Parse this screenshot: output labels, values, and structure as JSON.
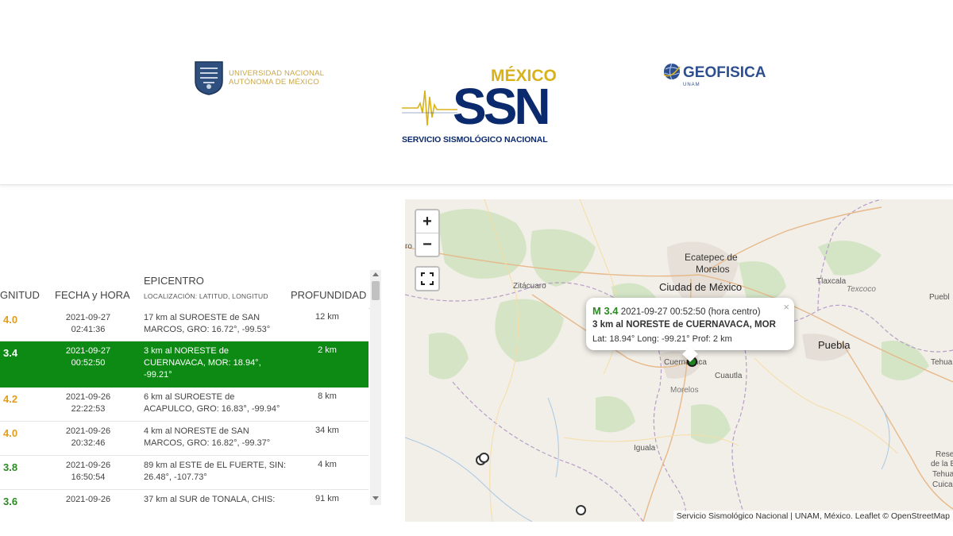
{
  "header": {
    "unam_logo_text_line1": "UNIVERSIDAD NACIONAL",
    "unam_logo_text_line2": "AUTÓNOMA DE MÉXICO",
    "ssn_country": "MÉXICO",
    "ssn_acronym": "SSN",
    "ssn_name": "SERVICIO SISMOLÓGICO NACIONAL",
    "geo_logo_text": "GEOFISICA",
    "geo_logo_sub": "UNAM"
  },
  "table": {
    "columns": {
      "magnitude": "GNITUD",
      "datetime": "FECHA y HORA",
      "epicenter": "EPICENTRO",
      "epicenter_sub": "LOCALIZACIÓN: LATITUD, LONGITUD",
      "depth": "PROFUNDIDAD"
    },
    "rows": [
      {
        "mag": "4.0",
        "date": "2021-09-27",
        "time": "02:41:36",
        "epi": "17 km al SUROESTE de SAN MARCOS, GRO: 16.72°, -99.53°",
        "depth": "12 km",
        "color": "#e39c1b"
      },
      {
        "mag": "3.4",
        "date": "2021-09-27",
        "time": "00:52:50",
        "epi": "3 km al NORESTE de CUERNAVACA, MOR: 18.94°, -99.21°",
        "depth": "2 km",
        "color": "#ffffff",
        "selected": true
      },
      {
        "mag": "4.2",
        "date": "2021-09-26",
        "time": "22:22:53",
        "epi": "6 km al SUROESTE de ACAPULCO, GRO: 16.83°, -99.94°",
        "depth": "8 km",
        "color": "#e39c1b"
      },
      {
        "mag": "4.0",
        "date": "2021-09-26",
        "time": "20:32:46",
        "epi": "4 km al NORESTE de SAN MARCOS, GRO: 16.82°, -99.37°",
        "depth": "34 km",
        "color": "#e39c1b"
      },
      {
        "mag": "3.8",
        "date": "2021-09-26",
        "time": "16:50:54",
        "epi": "89 km al ESTE de EL FUERTE, SIN: 26.48°, -107.73°",
        "depth": "4 km",
        "color": "#2c8a22"
      },
      {
        "mag": "3.6",
        "date": "2021-09-26",
        "time": "",
        "epi": "37 km al SUR de TONALA, CHIS:",
        "depth": "91 km",
        "color": "#2c8a22"
      }
    ]
  },
  "map": {
    "zoom_in": "+",
    "zoom_out": "−",
    "cities": {
      "ecatepec_1": "Ecatepec de",
      "ecatepec_2": "Morelos",
      "cdmx": "Ciudad de México",
      "zitacuaro": "Zitácuaro",
      "tlaxcala": "Tlaxcala",
      "puebla": "Puebla",
      "cuernavaca": "Cuernavaca",
      "cuautla": "Cuautla",
      "morelos": "Morelos",
      "iguala": "Iguala",
      "texcoco": "Texcoco",
      "puebl_edge": "Puebl",
      "tehua_edge": "Tehua",
      "res_edge": "Rese",
      "dela_edge": "de la B",
      "tehuac_edge": "Tehua",
      "cuic_edge": "Cuica",
      "left_edge": "ro"
    },
    "popup": {
      "mag": "M 3.4",
      "datetime": "2021-09-27  00:52:50 (hora centro)",
      "location": "3 km al NORESTE de CUERNAVACA, MOR",
      "coords": "Lat: 18.94°  Long: -99.21°  Prof: 2 km",
      "close": "×"
    },
    "attribution": "Servicio Sismológico Nacional | UNAM, México.  Leaflet © OpenStreetMap"
  },
  "colors": {
    "selected_row": "#0c8a14",
    "mag_orange": "#e39c1b",
    "mag_green": "#2c8a22",
    "ssn_blue": "#0b2a6e",
    "ssn_gold": "#d9b21a"
  }
}
